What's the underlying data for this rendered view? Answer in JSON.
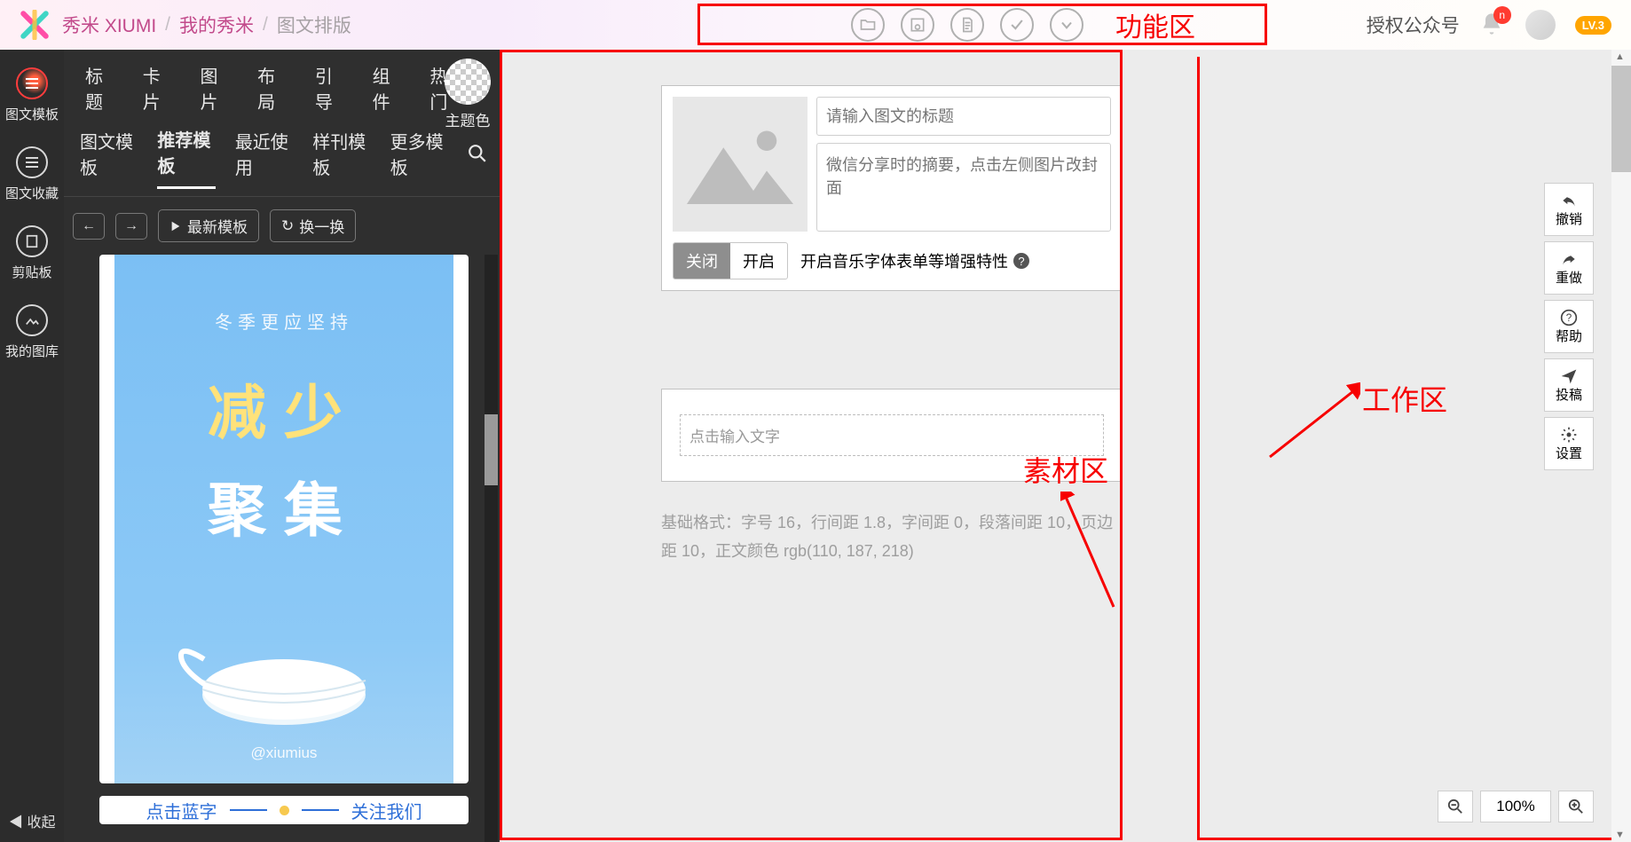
{
  "header": {
    "brand": "秀米 XIUMI",
    "crumb1": "我的秀米",
    "crumb2": "图文排版",
    "function_area_label": "功能区",
    "auth": "授权公众号",
    "notif_letter": "n",
    "level_badge": "LV.3"
  },
  "rail": {
    "items": [
      "图文模板",
      "图文收藏",
      "剪贴板",
      "我的图库"
    ],
    "collapse": "收起"
  },
  "panel": {
    "tabs": [
      "标题",
      "卡片",
      "图片",
      "布局",
      "引导",
      "组件",
      "热门"
    ],
    "subtabs": [
      "图文模板",
      "推荐模板",
      "最近使用",
      "样刊模板",
      "更多模板"
    ],
    "active_subtab": 1,
    "theme_label": "主题色",
    "btn_latest": "最新模板",
    "btn_shuffle": "换一换",
    "poster": {
      "sub": "冬季更应坚持",
      "line1": "减少",
      "line2": "聚集",
      "at": "@xiumius"
    },
    "tpl2_left": "点击蓝字",
    "tpl2_right": "关注我们"
  },
  "annotations": {
    "material_area": "素材区",
    "work_area": "工作区"
  },
  "editor": {
    "title_placeholder": "请输入图文的标题",
    "summary_placeholder": "微信分享时的摘要，点击左侧图片改封面",
    "toggle_off": "关闭",
    "toggle_on": "开启",
    "toggle_text": "开启音乐字体表单等增强特性",
    "content_placeholder": "点击输入文字",
    "base_format": "基础格式：字号 16，行间距 1.8，字间距 0，段落间距 10，页边距 10，正文颜色 rgb(110, 187, 218)"
  },
  "float": {
    "undo": "撤销",
    "redo": "重做",
    "help": "帮助",
    "post": "投稿",
    "settings": "设置"
  },
  "zoom": {
    "value": "100%"
  }
}
